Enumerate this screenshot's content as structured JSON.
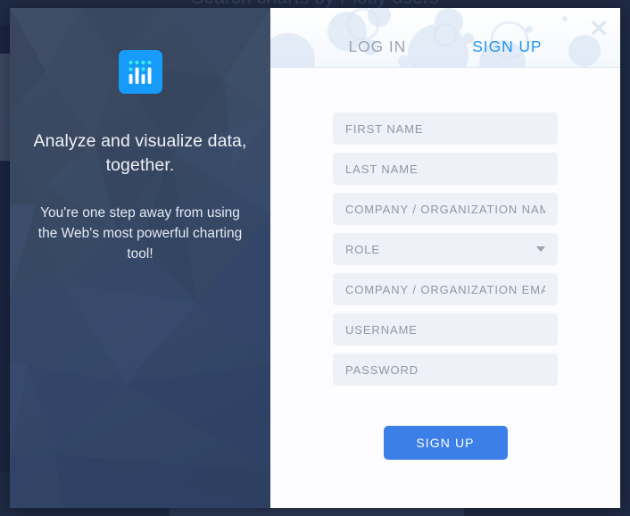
{
  "backdrop": {
    "page_title": "Search charts by Plotly users"
  },
  "modal": {
    "close_icon": "close-icon",
    "close_label": "✕",
    "tabs": [
      {
        "id": "log-in",
        "label": "LOG IN",
        "active": false
      },
      {
        "id": "sign-up",
        "label": "SIGN UP",
        "active": true
      }
    ],
    "hero": {
      "logo_icon": "plotly-logo-icon",
      "headline": "Analyze and visualize data, together.",
      "subtext": "You're one step away from using the Web's most powerful charting tool!"
    },
    "form": {
      "fields": [
        {
          "name": "first-name",
          "placeholder": "FIRST NAME",
          "value": "",
          "type": "text",
          "control": "input"
        },
        {
          "name": "last-name",
          "placeholder": "LAST NAME",
          "value": "",
          "type": "text",
          "control": "input"
        },
        {
          "name": "company-name",
          "placeholder": "COMPANY / ORGANIZATION NAME",
          "value": "",
          "type": "text",
          "control": "input"
        },
        {
          "name": "role",
          "placeholder": "ROLE",
          "value": "",
          "type": "text",
          "control": "select"
        },
        {
          "name": "company-email",
          "placeholder": "COMPANY / ORGANIZATION EMAIL",
          "value": "",
          "type": "text",
          "control": "input"
        },
        {
          "name": "username",
          "placeholder": "USERNAME",
          "value": "",
          "type": "text",
          "control": "input"
        },
        {
          "name": "password",
          "placeholder": "PASSWORD",
          "value": "",
          "type": "password",
          "control": "input"
        }
      ],
      "submit_label": "SIGN UP"
    }
  },
  "colors": {
    "accent_blue": "#2196f3",
    "button_blue": "#3d7fe8",
    "logo_blue": "#169bfa",
    "logo_dot_cyan": "#3ee8f0",
    "hero_dark": "#3d4a63",
    "input_bg": "#eef1f7",
    "placeholder": "#8f98a6",
    "tab_inactive": "#9aa4b3"
  }
}
